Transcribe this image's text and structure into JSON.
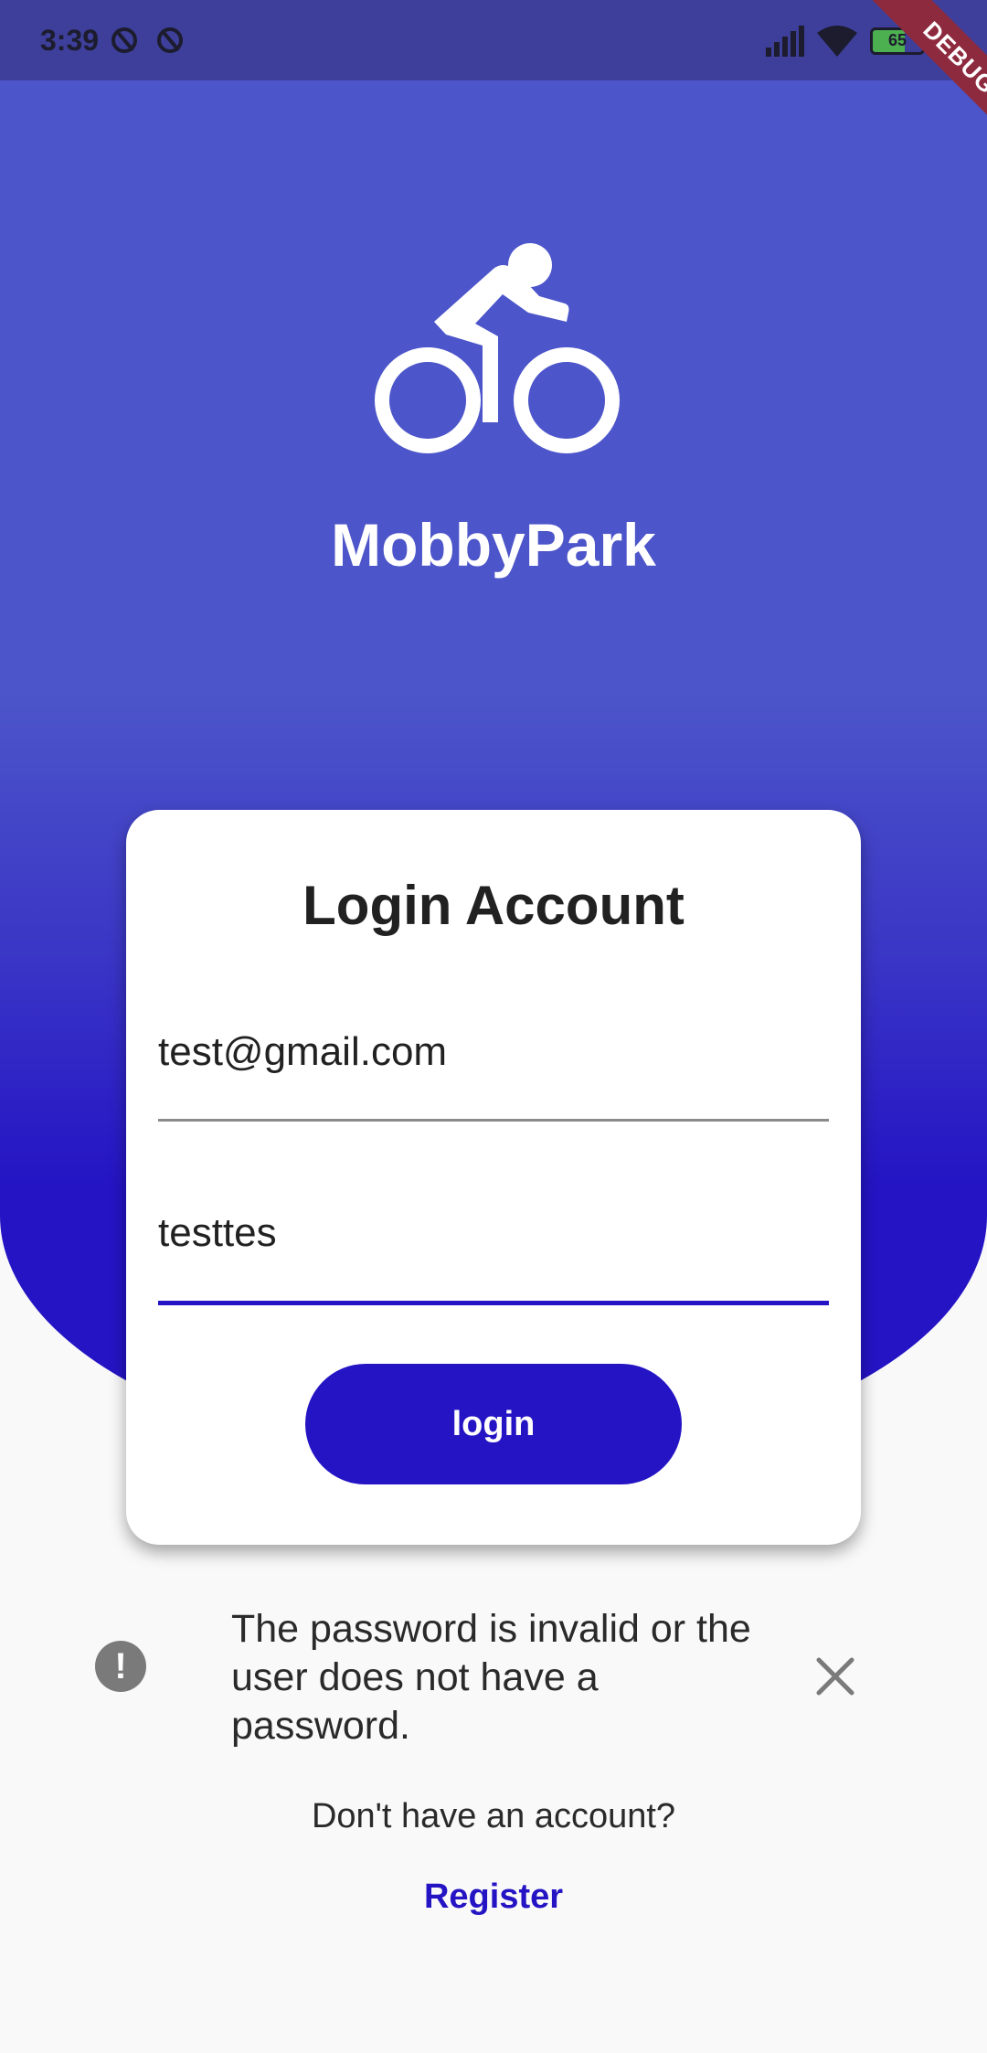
{
  "status_bar": {
    "time": "3:39",
    "battery_level": "65",
    "battery_fraction": 0.65,
    "icons": [
      "notification-circle-icon",
      "notification-circle-icon",
      "signal-icon",
      "wifi-icon",
      "battery-icon"
    ]
  },
  "debug_banner": "DEBUG",
  "header": {
    "logo_icon": "bike-icon",
    "app_title": "MobbyPark"
  },
  "login_card": {
    "title": "Login Account",
    "email_value": "test@gmail.com",
    "password_value": "testtes",
    "login_button": "login"
  },
  "error_banner": {
    "icon": "error-icon",
    "message": "The password is invalid or the user does not have a password.",
    "close_icon": "close-icon"
  },
  "footer": {
    "prompt": "Don't have an account?",
    "register_link": "Register"
  },
  "colors": {
    "primary": "#2414c4",
    "header_top": "#4c55c9",
    "status_bar": "#3d3f9a",
    "background": "#f9f9f9",
    "debug_ribbon": "#8e2a3e"
  }
}
